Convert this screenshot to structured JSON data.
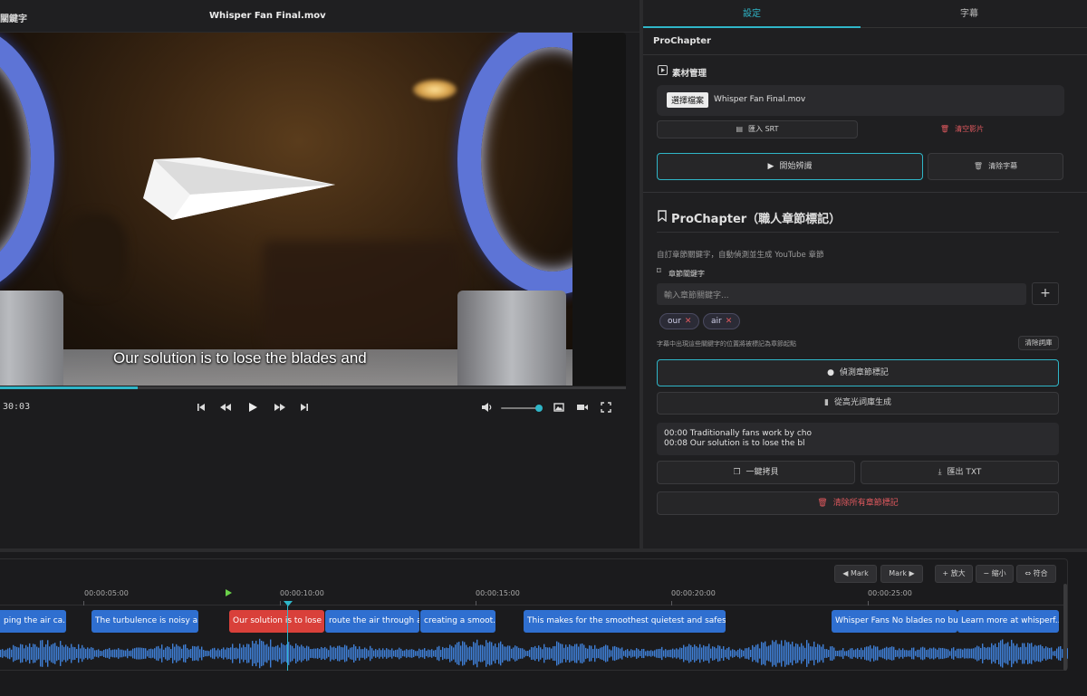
{
  "header": {
    "left_fragment": "關鍵字",
    "file_title": "Whisper Fan Final.mov"
  },
  "player": {
    "subtitle": "Our solution is to lose the blades and",
    "current_time": "30:03",
    "progress_fraction": 0.22,
    "volume_fraction": 0.95,
    "colors": {
      "accent": "#2fb6c8",
      "fan_blue": "#5d74d6"
    },
    "icons": [
      "skip-back-icon",
      "rewind-icon",
      "play-icon",
      "fast-forward-icon",
      "skip-forward-icon",
      "volume-icon",
      "image-icon",
      "camera-icon",
      "fullscreen-icon"
    ]
  },
  "tabs": [
    {
      "label": "設定",
      "active": true
    },
    {
      "label": "字幕",
      "active": false
    }
  ],
  "settings": {
    "heading": "ProChapter",
    "media": {
      "title": "素材管理",
      "choose_file": "選擇檔案",
      "file_name": "Whisper Fan Final.mov",
      "import_srt": "匯入 SRT",
      "clear_video": "清空影片",
      "start_recognize": "開始辨識",
      "clear_subtitles": "清除字幕"
    },
    "prochapter": {
      "title": "ProChapter（職人章節標記）",
      "description": "自訂章節關鍵字，自動偵測並生成 YouTube 章節",
      "keywords_label": "章節關鍵字",
      "input_placeholder": "輸入章節關鍵字...",
      "add": "+",
      "tags": [
        "our",
        "air"
      ],
      "hint": "字幕中出現這些關鍵字的位置將被標記為章節起點",
      "clear_library": "清除詞庫",
      "detect": "偵測章節標記",
      "from_highlights": "從高光詞庫生成",
      "chapters": [
        "00:00 Traditionally fans work by cho",
        "00:08 Our solution is to lose the bl"
      ],
      "copy_all": "一鍵拷貝",
      "export_txt": "匯出 TXT",
      "clear_all": "清除所有章節標記"
    }
  },
  "timeline": {
    "buttons": {
      "mark_prev": "◀ Mark",
      "mark_next": "Mark ▶",
      "zoom_in": "+ 放大",
      "zoom_out": "− 縮小",
      "fit": "⇔ 符合"
    },
    "ruler": [
      "00:00:05:00",
      "00:00:10:00",
      "00:00:15:00",
      "00:00:20:00",
      "00:00:25:00"
    ],
    "clips": [
      "ping the air ca...",
      "The turbulence is noisy a...",
      "Our solution is to lose ...",
      "route the air through a...",
      "creating a smoot...",
      "This makes for the smoothest quietest and safest fa...",
      "Whisper Fans No blades no bu...",
      "Learn more at whisperf..."
    ],
    "active_clip_index": 2
  }
}
